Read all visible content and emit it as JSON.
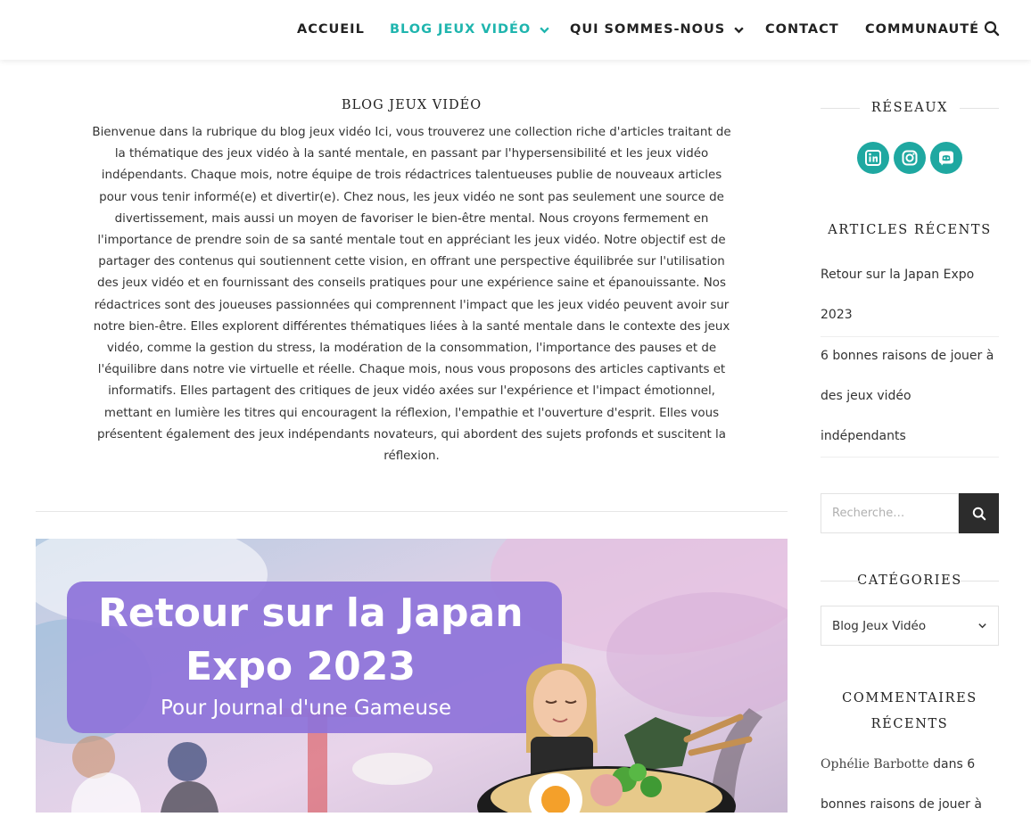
{
  "nav": {
    "items": [
      "ACCUEIL",
      "BLOG JEUX VIDÉO",
      "QUI SOMMES-NOUS",
      "CONTACT",
      "COMMUNAUTÉ"
    ],
    "active": "BLOG JEUX VIDÉO",
    "accent_color": "#1fb5ae"
  },
  "main": {
    "title": "BLOG JEUX VIDÉO",
    "intro": "Bienvenue dans la rubrique du blog jeux vidéo Ici, vous trouverez une collection riche d'articles traitant de la thématique des jeux vidéo à la santé mentale, en passant par l'hypersensibilité et les jeux vidéo indépendants. Chaque mois, notre équipe de trois rédactrices talentueuses publie de nouveaux articles pour vous tenir informé(e) et divertir(e). Chez nous, les jeux vidéo ne sont pas seulement une source de divertissement, mais aussi un moyen de favoriser le bien-être mental. Nous croyons fermement en l'importance de prendre soin de sa santé mentale tout en appréciant les jeux vidéo. Notre objectif est de partager des contenus qui soutiennent cette vision, en offrant une perspective équilibrée sur l'utilisation des jeux vidéo et en fournissant des conseils pratiques pour une expérience saine et épanouissante. Nos rédactrices sont des joueuses passionnées qui comprennent l'impact que les jeux vidéo peuvent avoir sur notre bien-être. Elles explorent différentes thématiques liées à la santé mentale dans le contexte des jeux vidéo, comme la gestion du stress, la modération de la consommation, l'importance des pauses et de l'équilibre dans notre vie virtuelle et réelle. Chaque mois, nous vous proposons des articles captivants et informatifs. Elles partagent des critiques de jeux vidéo axées sur l'expérience et l'impact émotionnel, mettant en lumière les titres qui encouragent la réflexion, l'empathie et l'ouverture d'esprit. Elles vous présentent également des jeux indépendants novateurs, qui abordent des sujets profonds et suscitent la réflexion.",
    "featured": {
      "title_line1": "Retour sur la Japan",
      "title_line2": "Expo 2023",
      "subtitle": "Pour Journal d'une Gameuse"
    }
  },
  "sidebar": {
    "social_title": "RÉSEAUX",
    "social_icons": [
      "linkedin-icon",
      "instagram-icon",
      "discord-icon"
    ],
    "social_color": "#1fa8a1",
    "recent_title": "ARTICLES RÉCENTS",
    "recent_1": [
      "Retour sur la Japan Expo",
      "2023"
    ],
    "recent_2": [
      "6 bonnes raisons de jouer à",
      "des jeux vidéo",
      "indépendants"
    ],
    "search_placeholder": "Recherche…",
    "categories_title": "CATÉGORIES",
    "category_selected": "Blog Jeux Vidéo",
    "comments_title_1": "COMMENTAIRES",
    "comments_title_2": "RÉCENTS",
    "comment_author": "Ophélie Barbotte",
    "comment_dans": " dans 6",
    "comment_line2": "bonnes raisons de jouer à"
  }
}
